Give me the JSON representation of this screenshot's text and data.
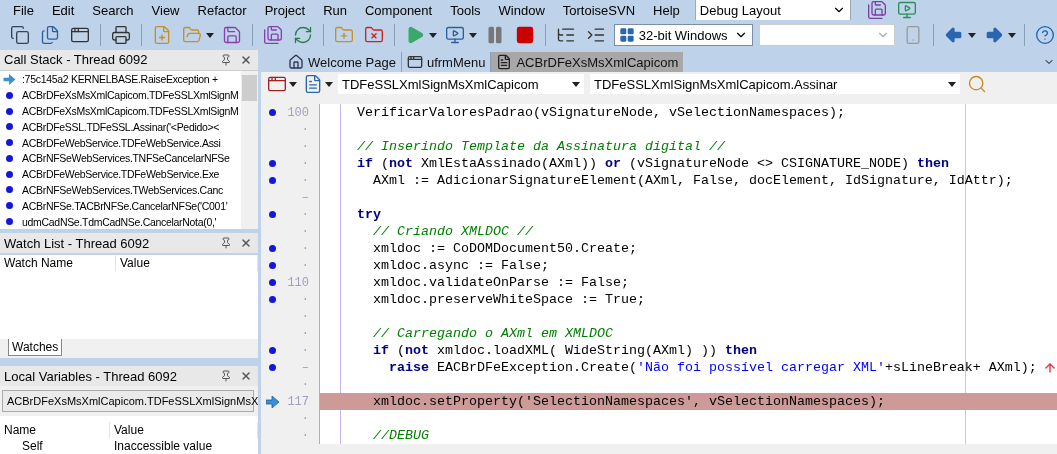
{
  "menu": [
    {
      "label": "File"
    },
    {
      "label": "Edit"
    },
    {
      "label": "Search"
    },
    {
      "label": "View"
    },
    {
      "label": "Refactor"
    },
    {
      "label": "Project"
    },
    {
      "label": "Run"
    },
    {
      "label": "Component"
    },
    {
      "label": "Tools"
    },
    {
      "label": "Window"
    },
    {
      "label": "TortoiseSVN"
    },
    {
      "label": "Help"
    }
  ],
  "layout_combo": {
    "value": "Debug Layout"
  },
  "platform_combo": {
    "value": "32-bit Windows"
  },
  "call_stack": {
    "title": "Call Stack - Thread 6092",
    "frames": [
      {
        "text": ":75c145a2 KERNELBASE.RaiseException +",
        "current": true
      },
      {
        "text": "ACBrDFeXsMsXmlCapicom.TDFeSSLXmlSignM",
        "current": false
      },
      {
        "text": "ACBrDFeXsMsXmlCapicom.TDFeSSLXmlSignM",
        "current": false
      },
      {
        "text": "ACBrDFeSSL.TDFeSSL.Assinar('<Pedido><",
        "current": false
      },
      {
        "text": "ACBrDFeWebService.TDFeWebService.Assi",
        "current": false
      },
      {
        "text": "ACBrNFSeWebServices.TNFSeCancelarNFSe",
        "current": false
      },
      {
        "text": "ACBrDFeWebService.TDFeWebService.Exe",
        "current": false
      },
      {
        "text": "ACBrNFSeWebServices.TWebServices.Canc",
        "current": false
      },
      {
        "text": "ACBrNFSe.TACBrNFSe.CancelarNFSe('C001'",
        "current": false
      },
      {
        "text": "udmCadNSe.TdmCadNSe.CancelarNota(0,'",
        "current": false
      }
    ]
  },
  "watch_list": {
    "title": "Watch List - Thread 6092",
    "columns": [
      "Watch Name",
      "Value"
    ],
    "tabs": [
      {
        "label": "Watches",
        "selected": true
      }
    ]
  },
  "local_variables": {
    "title": "Local Variables - Thread 6092",
    "frame_combo": "ACBrDFeXsMsXmlCapicom.TDFeSSLXmlSignMsX",
    "columns": [
      "Name",
      "Value"
    ],
    "rows": [
      {
        "name": "Self",
        "value": "Inaccessible value"
      }
    ]
  },
  "editor": {
    "tabs": [
      {
        "label": "Welcome Page",
        "kind": "home",
        "selected": false
      },
      {
        "label": "ufrmMenu",
        "kind": "form",
        "selected": false
      },
      {
        "label": "ACBrDFeXsMsXmlCapicom",
        "kind": "unit",
        "selected": true
      }
    ],
    "class_combo": "TDFeSSLXmlSignMsXmlCapicom",
    "method_combo": "TDFeSSLXmlSignMsXmlCapicom.Assinar",
    "lines": [
      {
        "gutter": "100",
        "compiled": true,
        "highlighted": false,
        "error_icon": false,
        "tokens": [
          {
            "kind": "plain",
            "text": "VerificarValoresPadrao(vSignatureNode, vSelectionNamespaces);"
          }
        ]
      },
      {
        "gutter": "·",
        "compiled": false,
        "highlighted": false,
        "error_icon": false
      },
      {
        "gutter": "·",
        "compiled": false,
        "highlighted": false,
        "error_icon": false,
        "tokens": [
          {
            "kind": "comment",
            "text": "// Inserindo Template da Assinatura digital //"
          }
        ]
      },
      {
        "gutter": "·",
        "compiled": true,
        "highlighted": false,
        "error_icon": false,
        "tokens": [
          {
            "kind": "keyword",
            "text": "if"
          },
          {
            "kind": "plain",
            "text": " ("
          },
          {
            "kind": "keyword",
            "text": "not"
          },
          {
            "kind": "plain",
            "text": " XmlEstaAssinado(AXml)) "
          },
          {
            "kind": "keyword",
            "text": "or"
          },
          {
            "kind": "plain",
            "text": " (vSignatureNode <> CSIGNATURE_NODE) "
          },
          {
            "kind": "keyword",
            "text": "then"
          }
        ]
      },
      {
        "gutter": "·",
        "compiled": true,
        "highlighted": false,
        "error_icon": false,
        "tokens": [
          {
            "kind": "plain",
            "text": "  AXml := AdicionarSignatureElement(AXml, False, docElement, IdSignature, IdAttr);"
          }
        ]
      },
      {
        "gutter": "–",
        "compiled": false,
        "highlighted": false,
        "error_icon": false
      },
      {
        "gutter": "·",
        "compiled": true,
        "highlighted": false,
        "error_icon": false,
        "tokens": [
          {
            "kind": "keyword",
            "text": "try"
          }
        ]
      },
      {
        "gutter": "·",
        "compiled": false,
        "highlighted": false,
        "error_icon": false,
        "tokens": [
          {
            "kind": "comment",
            "text": "  // Criando XMLDOC //"
          }
        ]
      },
      {
        "gutter": "·",
        "compiled": true,
        "highlighted": false,
        "error_icon": false,
        "tokens": [
          {
            "kind": "plain",
            "text": "  xmldoc := CoDOMDocument50.Create;"
          }
        ]
      },
      {
        "gutter": "·",
        "compiled": true,
        "highlighted": false,
        "error_icon": false,
        "tokens": [
          {
            "kind": "plain",
            "text": "  xmldoc.async := False;"
          }
        ]
      },
      {
        "gutter": "110",
        "compiled": true,
        "highlighted": false,
        "error_icon": false,
        "tokens": [
          {
            "kind": "plain",
            "text": "  xmldoc.validateOnParse := False;"
          }
        ]
      },
      {
        "gutter": "·",
        "compiled": true,
        "highlighted": false,
        "error_icon": false,
        "tokens": [
          {
            "kind": "plain",
            "text": "  xmldoc.preserveWhiteSpace := True;"
          }
        ]
      },
      {
        "gutter": "·",
        "compiled": false,
        "highlighted": false,
        "error_icon": false
      },
      {
        "gutter": "·",
        "compiled": false,
        "highlighted": false,
        "error_icon": false,
        "tokens": [
          {
            "kind": "comment",
            "text": "  // Carregando o AXml em XMLDOC"
          }
        ]
      },
      {
        "gutter": "·",
        "compiled": true,
        "highlighted": false,
        "error_icon": false,
        "tokens": [
          {
            "kind": "keyword",
            "text": "  if"
          },
          {
            "kind": "plain",
            "text": " ("
          },
          {
            "kind": "keyword",
            "text": "not"
          },
          {
            "kind": "plain",
            "text": " xmldoc.loadXML( WideString(AXml) )) "
          },
          {
            "kind": "keyword",
            "text": "then"
          }
        ]
      },
      {
        "gutter": "–",
        "compiled": true,
        "highlighted": false,
        "error_icon": true,
        "tokens": [
          {
            "kind": "keyword",
            "text": "    raise"
          },
          {
            "kind": "plain",
            "text": " EACBrDFeException.Create("
          },
          {
            "kind": "string",
            "text": "'Não foi possível carregar XML'"
          },
          {
            "kind": "plain",
            "text": "+sLineBreak+ AXml);"
          }
        ]
      },
      {
        "gutter": "·",
        "compiled": false,
        "highlighted": false,
        "error_icon": false
      },
      {
        "gutter": "117",
        "compiled": false,
        "highlighted": true,
        "error_icon": false,
        "tokens": [
          {
            "kind": "plain",
            "text": "  xmldoc.setProperty('SelectionNamespaces', vSelectionNamespaces);"
          }
        ]
      },
      {
        "gutter": "·",
        "compiled": false,
        "highlighted": false,
        "error_icon": false
      },
      {
        "gutter": "·",
        "compiled": false,
        "highlighted": false,
        "error_icon": false,
        "tokens": [
          {
            "kind": "comment",
            "text": "  //DEBUG"
          }
        ]
      }
    ]
  }
}
